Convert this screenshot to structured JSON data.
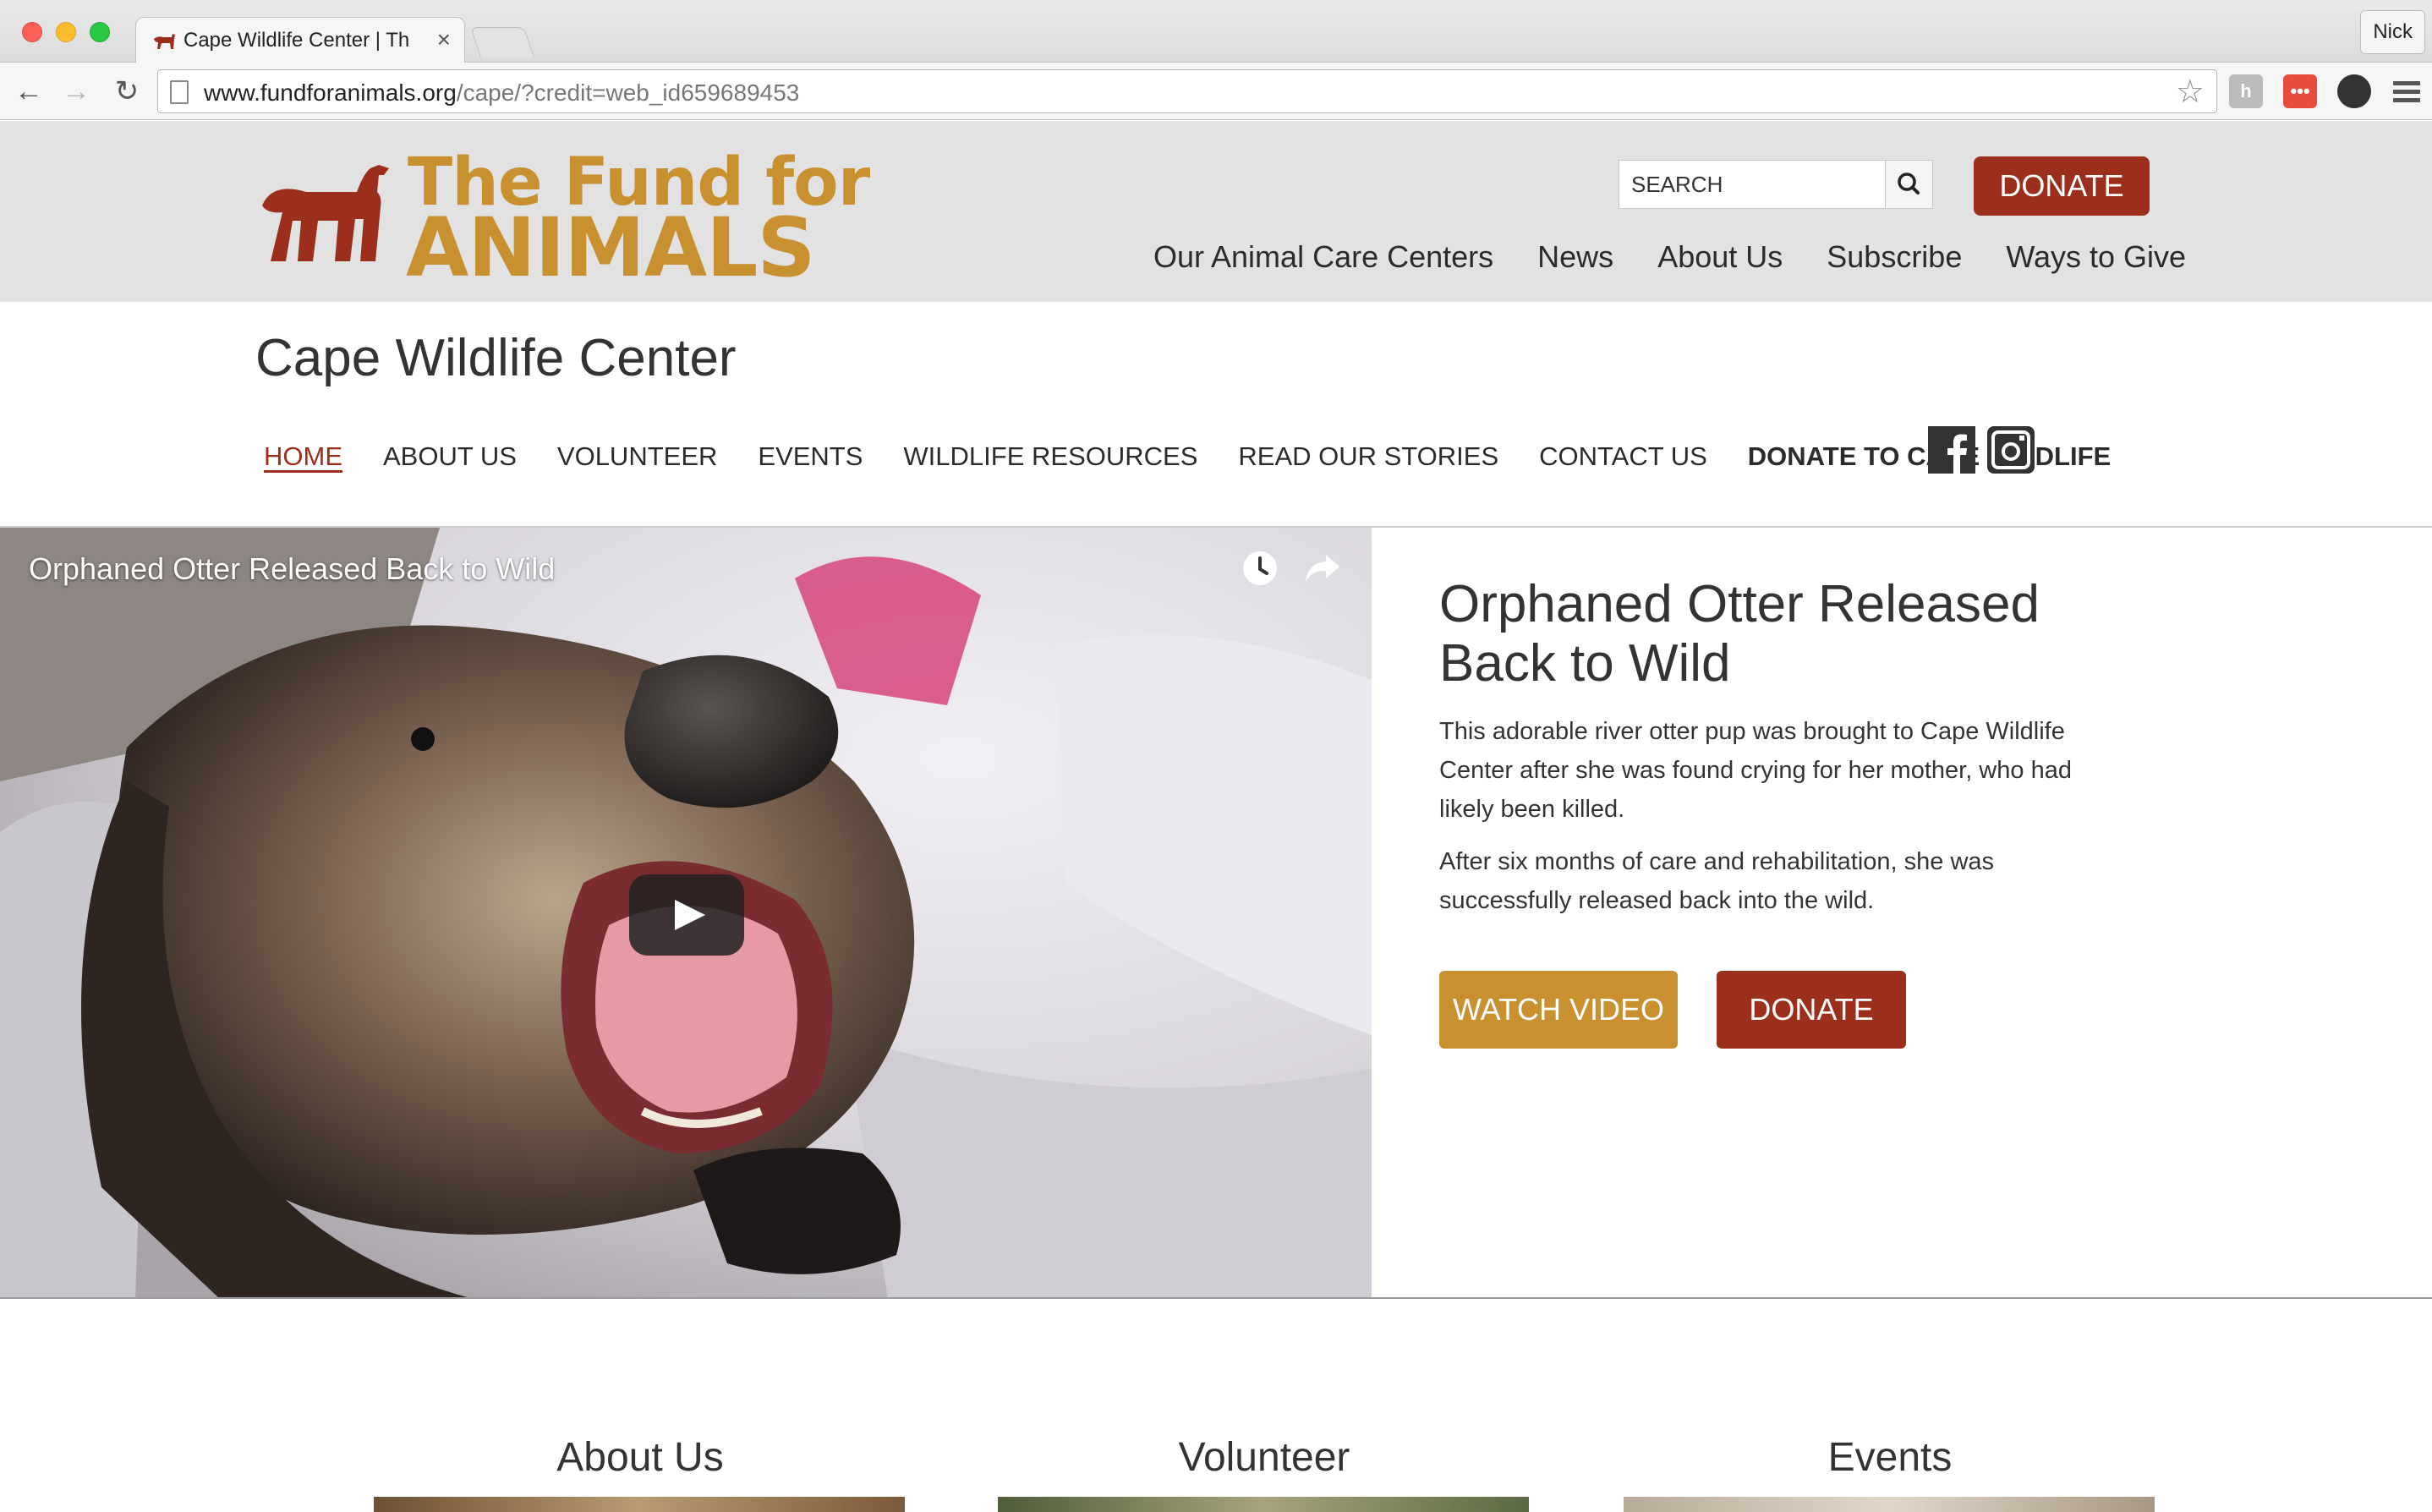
{
  "browser": {
    "tab_title": "Cape Wildlife Center | The Fund for Animals",
    "tab_close": "×",
    "profile_name": "Nick",
    "url_host": "www.fundforanimals.org",
    "url_rest": "/cape/?credit=web_id659689453",
    "nav_back": "←",
    "nav_forward": "→",
    "nav_reload": "↻",
    "star": "☆"
  },
  "header": {
    "logo_line1": "The Fund for",
    "logo_line2": "ANIMALS",
    "search_placeholder": "SEARCH",
    "donate_label": "DONATE",
    "nav": [
      "Our Animal Care Centers",
      "News",
      "About Us",
      "Subscribe",
      "Ways to Give"
    ]
  },
  "subsite": {
    "title": "Cape Wildlife Center",
    "nav": [
      {
        "label": "HOME",
        "active": true
      },
      {
        "label": "ABOUT US"
      },
      {
        "label": "VOLUNTEER"
      },
      {
        "label": "EVENTS"
      },
      {
        "label": "WILDLIFE RESOURCES"
      },
      {
        "label": "READ OUR STORIES"
      },
      {
        "label": "CONTACT US"
      },
      {
        "label": "DONATE TO CAPE WILDLIFE",
        "bold": true
      }
    ]
  },
  "hero": {
    "video_title": "Orphaned Otter Released Back to Wild",
    "story_title": "Orphaned Otter Released Back to Wild",
    "paragraph1": "This adorable river otter pup was brought to Cape Wildlife Center after she was found crying for her mother, who had likely been killed.",
    "paragraph2": "After six months of care and rehabilitation, she was successfully released back into the wild.",
    "watch_label": "WATCH VIDEO",
    "donate_label": "DONATE"
  },
  "cards": [
    "About Us",
    "Volunteer",
    "Events"
  ],
  "colors": {
    "brand_gold": "#c8902f",
    "brand_red": "#9b2f1c",
    "header_bg": "#e2e2e2"
  }
}
